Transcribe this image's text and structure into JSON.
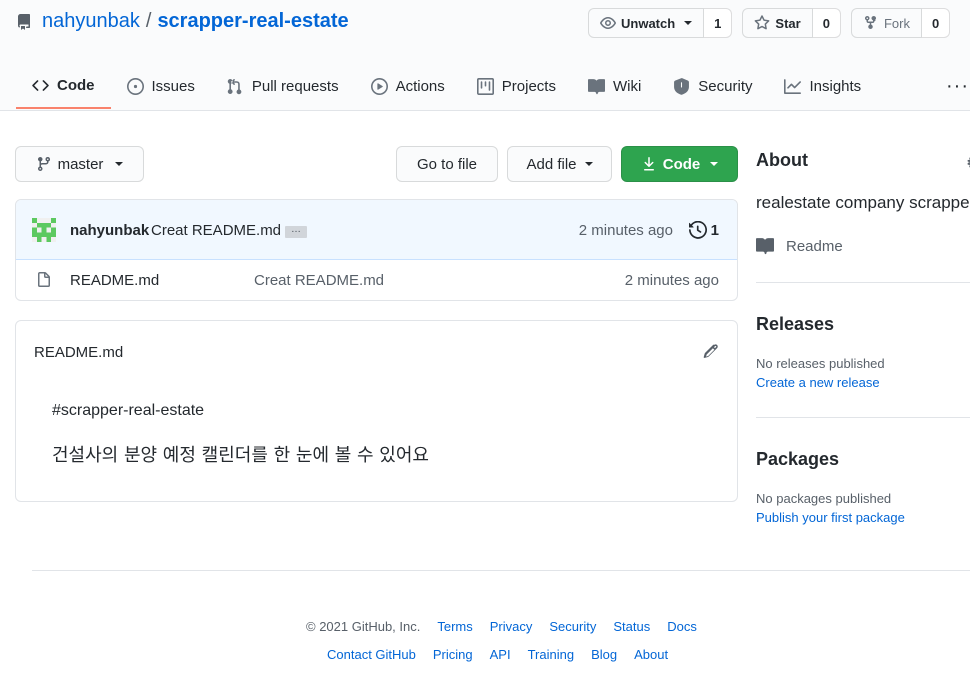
{
  "header": {
    "owner": "nahyunbak",
    "separator": "/",
    "repo": "scrapper-real-estate"
  },
  "actions": {
    "watch": {
      "label": "Unwatch",
      "count": "1"
    },
    "star": {
      "label": "Star",
      "count": "0"
    },
    "fork": {
      "label": "Fork",
      "count": "0"
    }
  },
  "tabs": [
    {
      "label": "Code",
      "icon": "code-icon",
      "selected": true
    },
    {
      "label": "Issues",
      "icon": "issue-icon"
    },
    {
      "label": "Pull requests",
      "icon": "pull-request-icon"
    },
    {
      "label": "Actions",
      "icon": "play-icon"
    },
    {
      "label": "Projects",
      "icon": "project-icon"
    },
    {
      "label": "Wiki",
      "icon": "book-icon"
    },
    {
      "label": "Security",
      "icon": "shield-icon"
    },
    {
      "label": "Insights",
      "icon": "graph-icon"
    }
  ],
  "tabs_more": "···",
  "toolbar": {
    "branch": "master",
    "go_to_file": "Go to file",
    "add_file": "Add file",
    "code": "Code"
  },
  "commit": {
    "author": "nahyunbak",
    "message": "Creat README.md",
    "ellipsis": "…",
    "time": "2 minutes ago",
    "history_count": "1"
  },
  "files": [
    {
      "name": "README.md",
      "message": "Creat README.md",
      "time": "2 minutes ago"
    }
  ],
  "readme": {
    "title": "README.md",
    "heading": "#scrapper-real-estate",
    "body": "건설사의 분양 예정 캘린더를 한 눈에 볼 수 있어요"
  },
  "sidebar": {
    "about_title": "About",
    "about_desc": "realestate company scrapper",
    "readme_label": "Readme",
    "releases_title": "Releases",
    "releases_note": "No releases published",
    "releases_link": "Create a new release",
    "packages_title": "Packages",
    "packages_note": "No packages published",
    "packages_link": "Publish your first package"
  },
  "footer": {
    "copyright": "© 2021 GitHub, Inc.",
    "row1": [
      "Terms",
      "Privacy",
      "Security",
      "Status",
      "Docs"
    ],
    "row2": [
      "Contact GitHub",
      "Pricing",
      "API",
      "Training",
      "Blog",
      "About"
    ]
  },
  "colors": {
    "link": "#0366d6",
    "primary_button": "#2ea44f",
    "tab_underline": "#f9826c",
    "commit_bg": "#f1f8ff"
  }
}
